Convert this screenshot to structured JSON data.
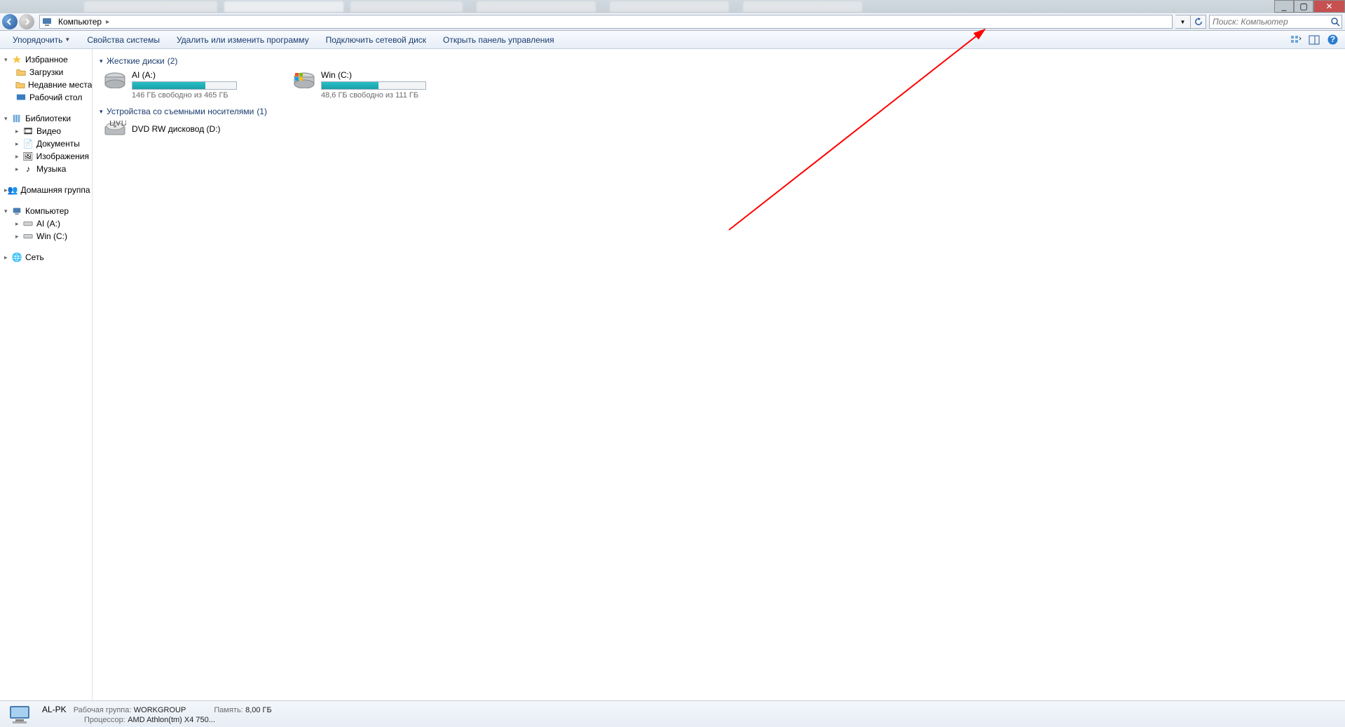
{
  "window_controls": {
    "minimize": "_",
    "maximize": "▢",
    "close": "✕"
  },
  "breadcrumb": {
    "root": "Компьютер"
  },
  "search": {
    "placeholder": "Поиск: Компьютер"
  },
  "toolbar": {
    "organize": "Упорядочить",
    "properties": "Свойства системы",
    "uninstall": "Удалить или изменить программу",
    "mapdrive": "Подключить сетевой диск",
    "controlpanel": "Открыть панель управления"
  },
  "sidebar": {
    "favorites": {
      "title": "Избранное",
      "items": [
        "Загрузки",
        "Недавние места",
        "Рабочий стол"
      ]
    },
    "libraries": {
      "title": "Библиотеки",
      "items": [
        "Видео",
        "Документы",
        "Изображения",
        "Музыка"
      ]
    },
    "homegroup": "Домашняя группа",
    "computer": {
      "title": "Компьютер",
      "items": [
        "AI (A:)",
        "Win (C:)"
      ]
    },
    "network": "Сеть"
  },
  "content": {
    "hdd_header": "Жесткие диски",
    "hdd_count": "(2)",
    "drives": [
      {
        "name": "AI (A:)",
        "info": "146 ГБ свободно из 465 ГБ",
        "fill_pct": 70
      },
      {
        "name": "Win (C:)",
        "info": "48,6 ГБ свободно из 111 ГБ",
        "fill_pct": 55
      }
    ],
    "removable_header": "Устройства со съемными носителями",
    "removable_count": "(1)",
    "dvd": "DVD RW дисковод (D:)"
  },
  "status": {
    "pc_name": "AL-PK",
    "workgroup_lbl": "Рабочая группа:",
    "workgroup_val": "WORKGROUP",
    "memory_lbl": "Память:",
    "memory_val": "8,00 ГБ",
    "cpu_lbl": "Процессор:",
    "cpu_val": "AMD Athlon(tm) X4 750..."
  }
}
